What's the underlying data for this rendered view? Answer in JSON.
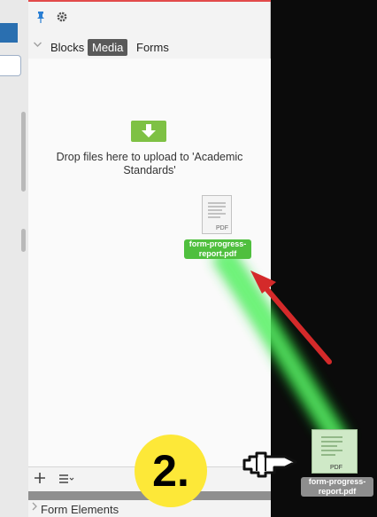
{
  "sidebar": {
    "tabs": [
      {
        "label": "Blocks",
        "active": false
      },
      {
        "label": "Media",
        "active": true
      },
      {
        "label": "Forms",
        "active": false
      }
    ]
  },
  "dropzone": {
    "message": "Drop files here to upload to 'Academic Standards'"
  },
  "files": {
    "ghost": {
      "type_label": "PDF",
      "name": "form-progress-report.pdf"
    },
    "dragged": {
      "type_label": "PDF",
      "name": "form-progress-report.pdf"
    }
  },
  "footer": {
    "section_label": "Form Elements"
  },
  "annotation": {
    "step": "2."
  },
  "icons": [
    "pin-icon",
    "gear-icon",
    "chevron-down-icon",
    "upload-arrow-icon",
    "pdf-file-icon",
    "plus-icon",
    "list-menu-icon",
    "caret-right-icon",
    "red-arrow",
    "pointing-hand-icon"
  ],
  "colors": {
    "accent_green": "#7ec144",
    "active_tab": "#595959",
    "callout_yellow": "#fde838",
    "arrow_red": "#d42a2a",
    "pin_blue": "#2a7fd4"
  }
}
